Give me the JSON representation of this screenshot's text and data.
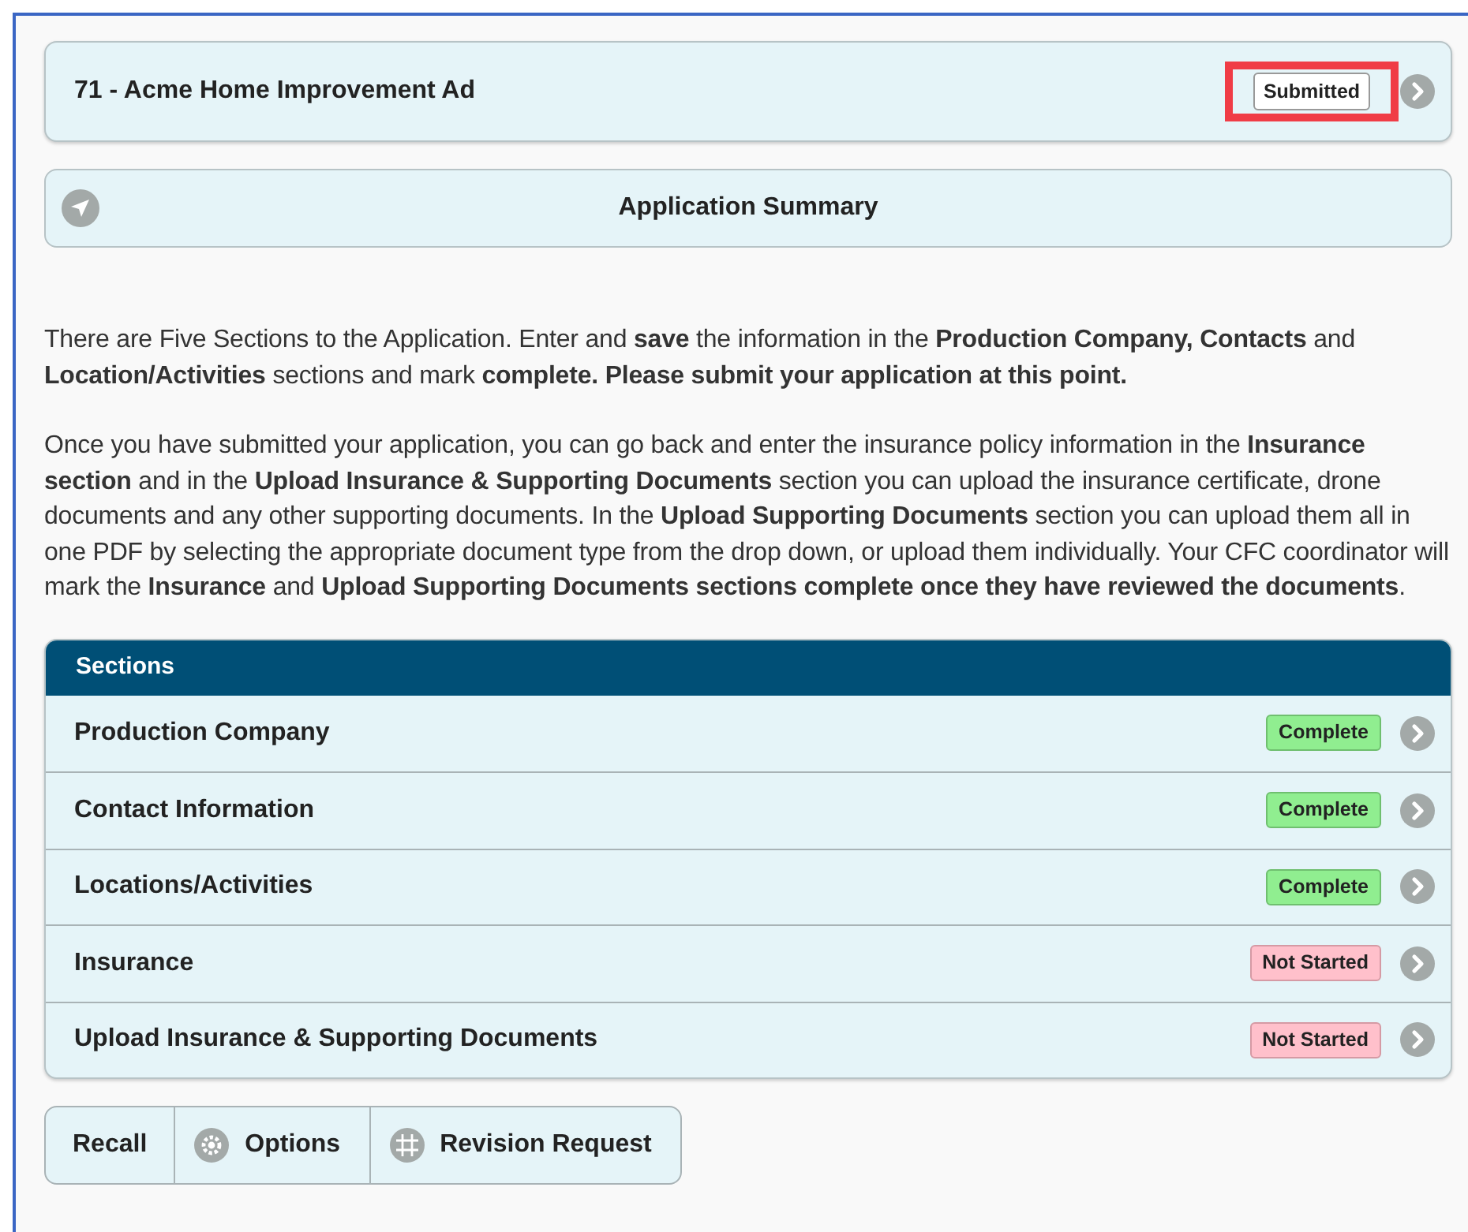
{
  "header": {
    "title": "71 - Acme Home Improvement Ad",
    "status": "Submitted",
    "highlighted": true
  },
  "summary": {
    "title": "Application Summary"
  },
  "paragraphs": [
    "There are Five Sections to the Application. Enter and **save** the information in the **Production Company, Contacts** and **Location/Activities** sections and mark **complete. Please submit your application at this point.**",
    "Once you have submitted your application, you can go back and enter the insurance policy information in the **Insurance section** and in the **Upload Insurance & Supporting Documents** section you can upload the insurance certificate, drone documents and any other supporting documents. In the **Upload Supporting Documents** section you can upload them all in one PDF by selecting the appropriate document type from the drop down, or upload them individually. Your CFC coordinator will mark the **Insurance** and **Upload Supporting Documents sections complete once they have reviewed the documents**."
  ],
  "sections": {
    "title": "Sections",
    "rows": [
      {
        "name": "Production Company",
        "status": "Complete",
        "kind": "complete"
      },
      {
        "name": "Contact Information",
        "status": "Complete",
        "kind": "complete"
      },
      {
        "name": "Locations/Activities",
        "status": "Complete",
        "kind": "complete"
      },
      {
        "name": "Insurance",
        "status": "Not Started",
        "kind": "not_started"
      },
      {
        "name": "Upload Insurance & Supporting Documents",
        "status": "Not Started",
        "kind": "not_started"
      }
    ]
  },
  "buttons": [
    {
      "label": "Recall",
      "kind": "plain"
    },
    {
      "label": "Options",
      "kind": "gear"
    },
    {
      "label": "Revision Request",
      "kind": "grid"
    }
  ]
}
